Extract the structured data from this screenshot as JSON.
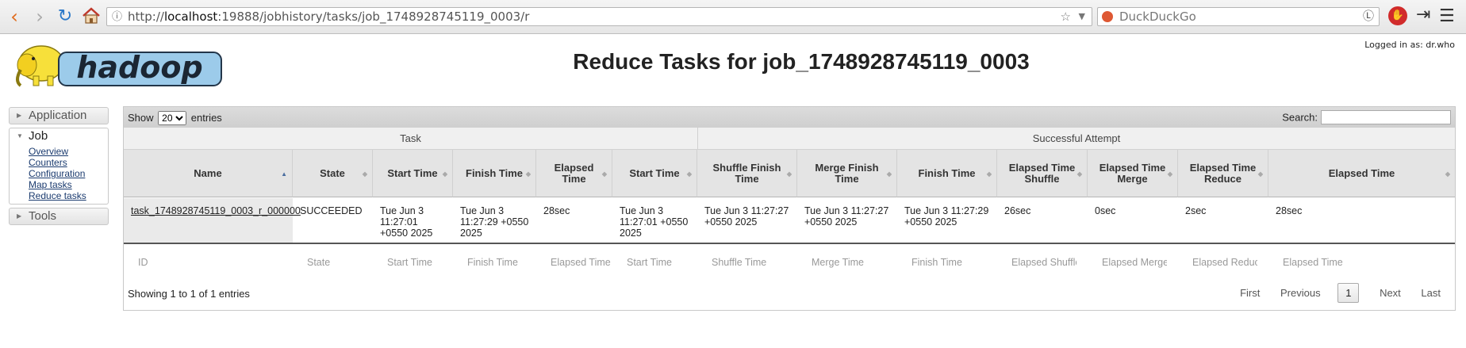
{
  "browser": {
    "url_host": "localhost",
    "url_prefix": "http://",
    "url_rest": ":19888/jobhistory/tasks/job_1748928745119_0003/r",
    "search_engine": "DuckDuckGo"
  },
  "header": {
    "logged_in": "Logged in as: dr.who",
    "logo_text": "hadoop",
    "title": "Reduce Tasks for job_1748928745119_0003"
  },
  "sidebar": {
    "application": "Application",
    "job": "Job",
    "job_links": [
      "Overview",
      "Counters",
      "Configuration",
      "Map tasks",
      "Reduce tasks"
    ],
    "tools": "Tools"
  },
  "table": {
    "show": "Show",
    "entries_value": "20",
    "entries_options": [
      "20"
    ],
    "entries": "entries",
    "search_label": "Search:",
    "group_task": "Task",
    "group_attempt": "Successful Attempt",
    "headers": [
      "Name",
      "State",
      "Start Time",
      "Finish Time",
      "Elapsed Time",
      "Start Time",
      "Shuffle Finish Time",
      "Merge Finish Time",
      "Finish Time",
      "Elapsed Time Shuffle",
      "Elapsed Time Merge",
      "Elapsed Time Reduce",
      "Elapsed Time"
    ],
    "row": {
      "name": "task_1748928745119_0003_r_000000",
      "state": "SUCCEEDED",
      "start": "Tue Jun 3 11:27:01 +0550 2025",
      "finish": "Tue Jun 3 11:27:29 +0550 2025",
      "elapsed": "28sec",
      "att_start": "Tue Jun 3 11:27:01 +0550 2025",
      "shuffle_finish": "Tue Jun 3 11:27:27 +0550 2025",
      "merge_finish": "Tue Jun 3 11:27:27 +0550 2025",
      "att_finish": "Tue Jun 3 11:27:29 +0550 2025",
      "elapsed_shuffle": "26sec",
      "elapsed_merge": "0sec",
      "elapsed_reduce": "2sec",
      "att_elapsed": "28sec"
    },
    "filters": [
      "ID",
      "State",
      "Start Time",
      "Finish Time",
      "Elapsed Time",
      "Start Time",
      "Shuffle Time",
      "Merge Time",
      "Finish Time",
      "Elapsed Shuffle",
      "Elapsed Merge",
      "Elapsed Reduce",
      "Elapsed Time"
    ],
    "info": "Showing 1 to 1 of 1 entries",
    "pager": {
      "first": "First",
      "previous": "Previous",
      "current": "1",
      "next": "Next",
      "last": "Last"
    }
  }
}
